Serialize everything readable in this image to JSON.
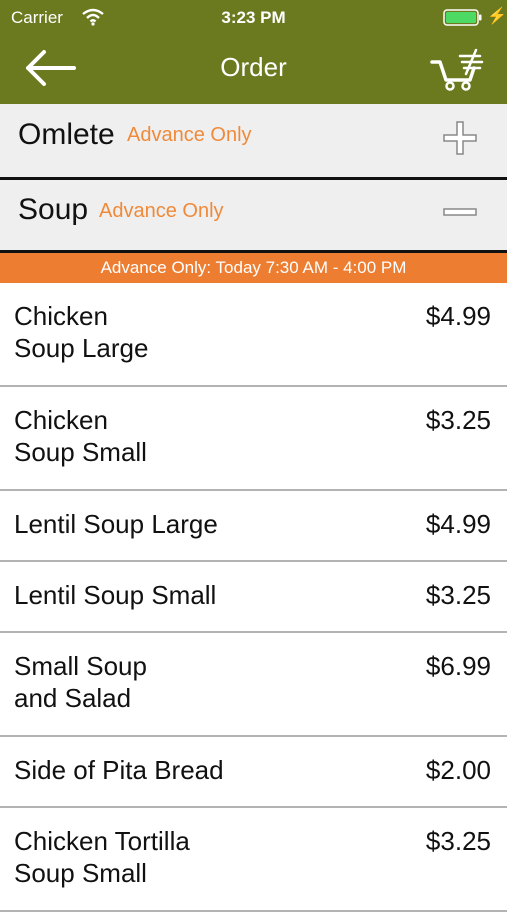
{
  "status_bar": {
    "carrier": "Carrier",
    "time": "3:23 PM"
  },
  "nav": {
    "title": "Order",
    "back_icon": "back-arrow-icon",
    "cart_icon": "cart-icon"
  },
  "categories": [
    {
      "name": "Omlete",
      "badge": "Advance Only",
      "toggle_icon": "plus-icon"
    },
    {
      "name": "Soup",
      "badge": "Advance Only",
      "toggle_icon": "minus-icon"
    }
  ],
  "banner": "Advance Only: Today 7:30 AM - 4:00 PM",
  "items": [
    {
      "name_line1": "Chicken",
      "name_line2": "Soup Large",
      "price": "$4.99"
    },
    {
      "name_line1": "Chicken",
      "name_line2": "Soup Small",
      "price": "$3.25"
    },
    {
      "name_line1": "Lentil Soup Large",
      "name_line2": "",
      "price": "$4.99"
    },
    {
      "name_line1": "Lentil Soup Small",
      "name_line2": "",
      "price": "$3.25"
    },
    {
      "name_line1": "Small Soup",
      "name_line2": "and Salad",
      "price": "$6.99"
    },
    {
      "name_line1": "Side of Pita Bread",
      "name_line2": "",
      "price": "$2.00"
    },
    {
      "name_line1": "Chicken Tortilla",
      "name_line2": "Soup Small",
      "price": "$3.25"
    }
  ],
  "colors": {
    "header": "#6b7a1f",
    "accent": "#ed7d31",
    "battery": "#4cd964"
  }
}
